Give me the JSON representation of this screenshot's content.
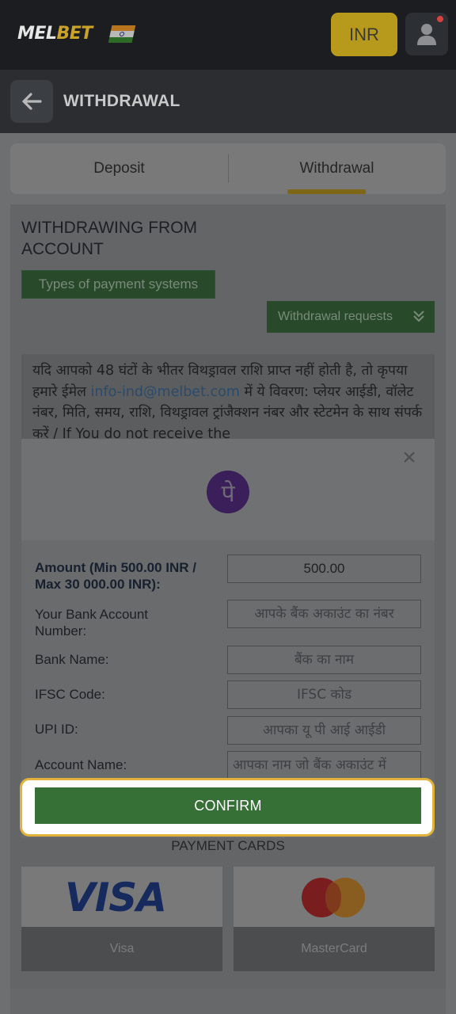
{
  "header": {
    "logo_part1": "MEL",
    "logo_part2": "BET",
    "currency_button": "INR",
    "flag_icon": "india-flag-icon",
    "user_icon": "user-icon"
  },
  "subheader": {
    "title": "WITHDRAWAL",
    "back_icon": "arrow-left-icon"
  },
  "tabs": [
    {
      "label": "Deposit",
      "active": false
    },
    {
      "label": "Withdrawal",
      "active": true
    }
  ],
  "section": {
    "title": "WITHDRAWING FROM ACCOUNT",
    "types_chip": "Types of payment systems",
    "requests_button": "Withdrawal requests"
  },
  "notice": {
    "text_before": "यदि आपको 48 घंटों के भीतर विथड्रावल राशि प्राप्त नहीं होती है, तो कृपया हमारे ईमेल ",
    "email": "info-ind@melbet.com",
    "text_after": " में ये विवरण: प्लेयर आईडी, वॉलेट नंबर, मिति, समय, राशि, विथड्रावल ट्रांजैक्शन नंबर और स्टेटमेन के साथ संपर्क करें / If You do not receive the"
  },
  "modal": {
    "close_icon": "close-icon",
    "method_icon": "phonepe-icon",
    "method_glyph": "पे",
    "fields": [
      {
        "label": "Amount (Min 500.00 INR / Max 30 000.00 INR):",
        "value": "500.00",
        "placeholder": ""
      },
      {
        "label": "Your Bank Account Number:",
        "value": "",
        "placeholder": "आपके बैंक अकाउंट का नंबर"
      },
      {
        "label": "Bank Name:",
        "value": "",
        "placeholder": "बैंक का नाम"
      },
      {
        "label": "IFSC Code:",
        "value": "",
        "placeholder": "IFSC कोड"
      },
      {
        "label": "UPI ID:",
        "value": "",
        "placeholder": "आपका यू पी आई आईडी"
      },
      {
        "label": "Account Name:",
        "value": "",
        "placeholder": "आपका नाम जो बैंक अकाउंट में"
      }
    ],
    "confirm_label": "CONFIRM"
  },
  "payment_cards": {
    "title": "PAYMENT CARDS",
    "cards": [
      {
        "logo_text": "VISA",
        "name": "Visa"
      },
      {
        "logo_text": "",
        "name": "MasterCard"
      }
    ]
  },
  "colors": {
    "accent_gold": "#e2b23a",
    "confirm_green": "#377037",
    "header_dark": "#1b1d20"
  }
}
